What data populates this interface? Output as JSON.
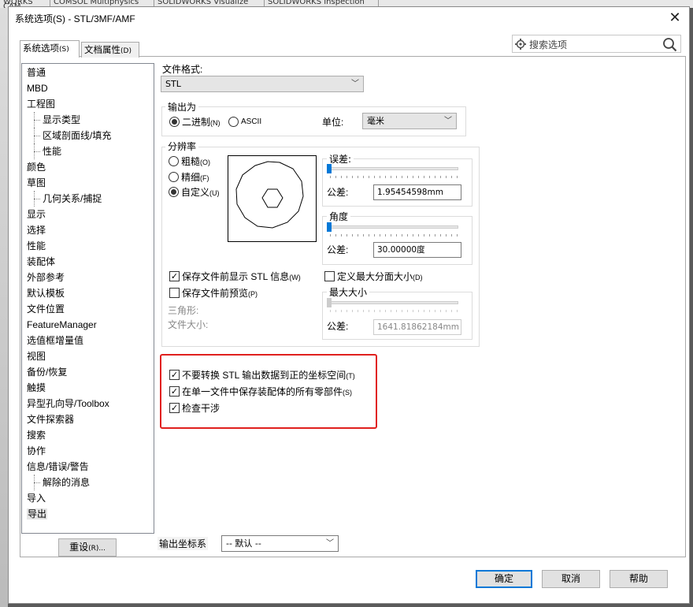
{
  "background_apps": [
    "WORKS CAM",
    "COMSOL Multiphysics",
    "SOLIDWORKS Visualize",
    "SOLIDWORKS Inspection"
  ],
  "window": {
    "title": "系统选项(S) - STL/3MF/AMF"
  },
  "tabs": [
    {
      "label": "系统选项",
      "accel": "(S)"
    },
    {
      "label": "文档属性",
      "accel": "(D)"
    }
  ],
  "search": {
    "placeholder": "搜索选项"
  },
  "tree": [
    {
      "label": "普通",
      "sub": false
    },
    {
      "label": "MBD",
      "sub": false
    },
    {
      "label": "工程图",
      "sub": false
    },
    {
      "label": "显示类型",
      "sub": true
    },
    {
      "label": "区域剖面线/填充",
      "sub": true
    },
    {
      "label": "性能",
      "sub": true
    },
    {
      "label": "颜色",
      "sub": false
    },
    {
      "label": "草图",
      "sub": false
    },
    {
      "label": "几何关系/捕捉",
      "sub": true
    },
    {
      "label": "显示",
      "sub": false
    },
    {
      "label": "选择",
      "sub": false
    },
    {
      "label": "性能",
      "sub": false
    },
    {
      "label": "装配体",
      "sub": false
    },
    {
      "label": "外部参考",
      "sub": false
    },
    {
      "label": "默认模板",
      "sub": false
    },
    {
      "label": "文件位置",
      "sub": false
    },
    {
      "label": "FeatureManager",
      "sub": false
    },
    {
      "label": "选值框增量值",
      "sub": false
    },
    {
      "label": "视图",
      "sub": false
    },
    {
      "label": "备份/恢复",
      "sub": false
    },
    {
      "label": "触摸",
      "sub": false
    },
    {
      "label": "异型孔向导/Toolbox",
      "sub": false
    },
    {
      "label": "文件探索器",
      "sub": false
    },
    {
      "label": "搜索",
      "sub": false
    },
    {
      "label": "协作",
      "sub": false
    },
    {
      "label": "信息/错误/警告",
      "sub": false
    },
    {
      "label": "解除的消息",
      "sub": true
    },
    {
      "label": "导入",
      "sub": false
    },
    {
      "label": "导出",
      "sub": false,
      "selected": true
    }
  ],
  "reset_button": {
    "label": "重设",
    "accel": "(R)..."
  },
  "file_format": {
    "label": "文件格式:",
    "value": "STL"
  },
  "output_as": {
    "title": "输出为",
    "binary": {
      "label": "二进制",
      "accel": "(N)",
      "checked": true
    },
    "ascii": {
      "label": "ASCII",
      "checked": false
    },
    "unit_label": "单位:",
    "unit_value": "毫米"
  },
  "resolution": {
    "title": "分辨率",
    "coarse": {
      "label": "粗糙",
      "accel": "(O)",
      "checked": false
    },
    "fine": {
      "label": "精细",
      "accel": "(F)",
      "checked": false
    },
    "custom": {
      "label": "自定义",
      "accel": "(U)",
      "checked": true
    },
    "deviation": {
      "title": "误差:",
      "tol_label": "公差:",
      "value": "1.95454598mm",
      "slider": 0.0
    },
    "angle": {
      "title": "角度",
      "tol_label": "公差:",
      "value": "30.00000度",
      "slider": 0.0
    }
  },
  "show_stl_info": {
    "label": "保存文件前显示 STL 信息",
    "accel": "(W)",
    "checked": true
  },
  "preview": {
    "label": "保存文件前预览",
    "accel": "(P)",
    "checked": false
  },
  "triangles_label": "三角形:",
  "file_size_label": "文件大小:",
  "max_facet": {
    "label": "定义最大分面大小",
    "accel": "(D)",
    "checked": false
  },
  "max_size": {
    "title": "最大大小",
    "tol_label": "公差:",
    "value": "1641.81862184mm"
  },
  "options": {
    "no_translate": {
      "label": "不要转换 STL 输出数据到正的坐标空间",
      "accel": "(T)",
      "checked": true
    },
    "single_file": {
      "label": "在单一文件中保存装配体的所有零部件",
      "accel": "(S)",
      "checked": true
    },
    "interference": {
      "label": "检查干涉",
      "checked": true
    }
  },
  "coord_system": {
    "label": "输出坐标系",
    "value": "-- 默认 --"
  },
  "buttons": {
    "ok": "确定",
    "cancel": "取消",
    "help": "帮助"
  },
  "colors": {
    "highlight": "#e0201e",
    "accent": "#0078d7"
  }
}
